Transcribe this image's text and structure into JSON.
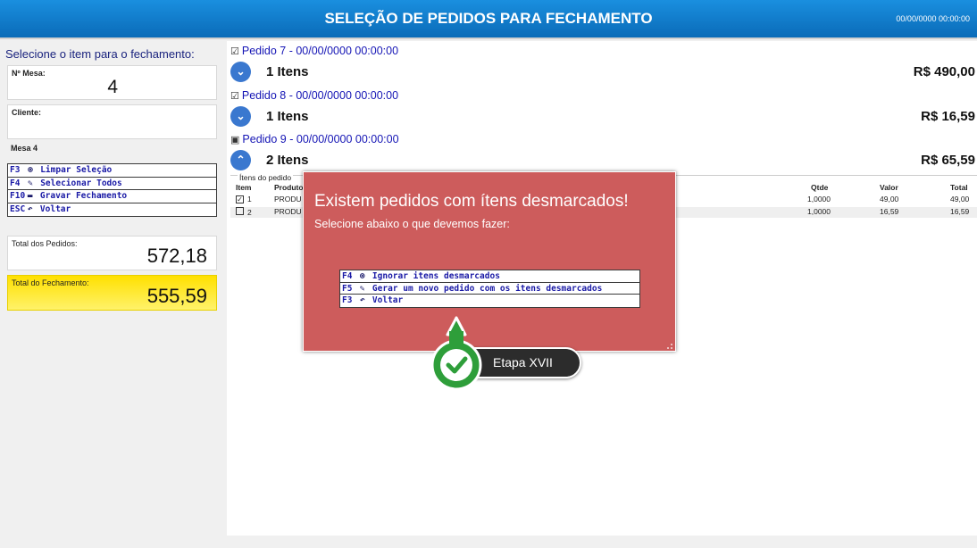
{
  "header": {
    "title": "SELEÇÃO DE PEDIDOS PARA FECHAMENTO",
    "datetime": "00/00/0000 00:00:00"
  },
  "sidebar": {
    "heading": "Selecione o item para o fechamento:",
    "mesa_label": "Nº Mesa:",
    "mesa_value": "4",
    "cliente_label": "Cliente:",
    "cliente_value": "",
    "mesa_info": "Mesa 4",
    "fkeys": [
      {
        "key": "F3",
        "icon": "clear-icon",
        "label": "Limpar Seleção"
      },
      {
        "key": "F4",
        "icon": "edit-icon",
        "label": "Selecionar Todos"
      },
      {
        "key": "F10",
        "icon": "save-icon",
        "label": "Gravar Fechamento"
      },
      {
        "key": "ESC",
        "icon": "back-arrow-icon",
        "label": "Voltar"
      }
    ],
    "total_pedidos_label": "Total dos Pedidos:",
    "total_pedidos_value": "572,18",
    "total_fechamento_label": "Total do Fechamento:",
    "total_fechamento_value": "555,59",
    "total_fechamento_color": "#ffe83a"
  },
  "pedidos": [
    {
      "header": "Pedido 7 - 00/00/0000 00:00:00",
      "checked": "☑",
      "expander": "chevron-down-icon",
      "items": "1 Itens",
      "total": "R$ 490,00"
    },
    {
      "header": "Pedido 8 - 00/00/0000 00:00:00",
      "checked": "☑",
      "expander": "chevron-down-icon",
      "items": "1 Itens",
      "total": "R$ 16,59"
    },
    {
      "header": "Pedido 9 - 00/00/0000 00:00:00",
      "checked": "▣",
      "expander": "chevron-up-icon",
      "items": "2 Itens",
      "total": "R$ 65,59"
    }
  ],
  "itens_grid": {
    "label": "Ítens do pedido",
    "headers": {
      "item": "Item",
      "produto": "Produto",
      "qtde": "Qtde",
      "valor": "Valor",
      "total": "Total"
    },
    "rows": [
      {
        "checked": "✓",
        "item": "1",
        "produto": "PRODU",
        "qtde": "1,0000",
        "valor": "49,00",
        "total": "49,00"
      },
      {
        "checked": "",
        "item": "2",
        "produto": "PRODU",
        "qtde": "1,0000",
        "valor": "16,59",
        "total": "16,59"
      }
    ]
  },
  "dialog": {
    "title": "Existem pedidos com ítens desmarcados!",
    "subtitle": "Selecione abaixo o que devemos fazer:",
    "background": "#cd5c5c",
    "options": [
      {
        "key": "F4",
        "icon": "clear-icon",
        "label": "Ignorar itens desmarcados"
      },
      {
        "key": "F5",
        "icon": "edit-icon",
        "label": "Gerar um novo pedido com os itens desmarcados"
      },
      {
        "key": "F3",
        "icon": "back-arrow-icon",
        "label": "Voltar"
      }
    ]
  },
  "step_badge": {
    "label": "Etapa XVII",
    "icon": "check-icon",
    "color": "#2e9e3a"
  }
}
